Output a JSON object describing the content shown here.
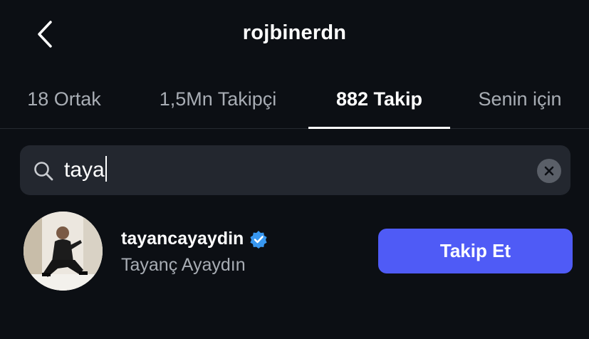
{
  "header": {
    "title": "rojbinerdn"
  },
  "tabs": [
    {
      "label": "18 Ortak"
    },
    {
      "label": "1,5Mn Takipçi"
    },
    {
      "label": "882 Takip",
      "active": true
    },
    {
      "label": "Senin için"
    }
  ],
  "search": {
    "value": "taya"
  },
  "results": [
    {
      "username": "tayancayaydin",
      "full_name": "Tayanç Ayaydın",
      "verified": true,
      "button_label": "Takip Et"
    }
  ],
  "colors": {
    "background": "#0c0f14",
    "search_bg": "#23272f",
    "accent": "#4f5bf6",
    "verified_badge": "#3897f0",
    "muted_text": "#a8adb4"
  }
}
